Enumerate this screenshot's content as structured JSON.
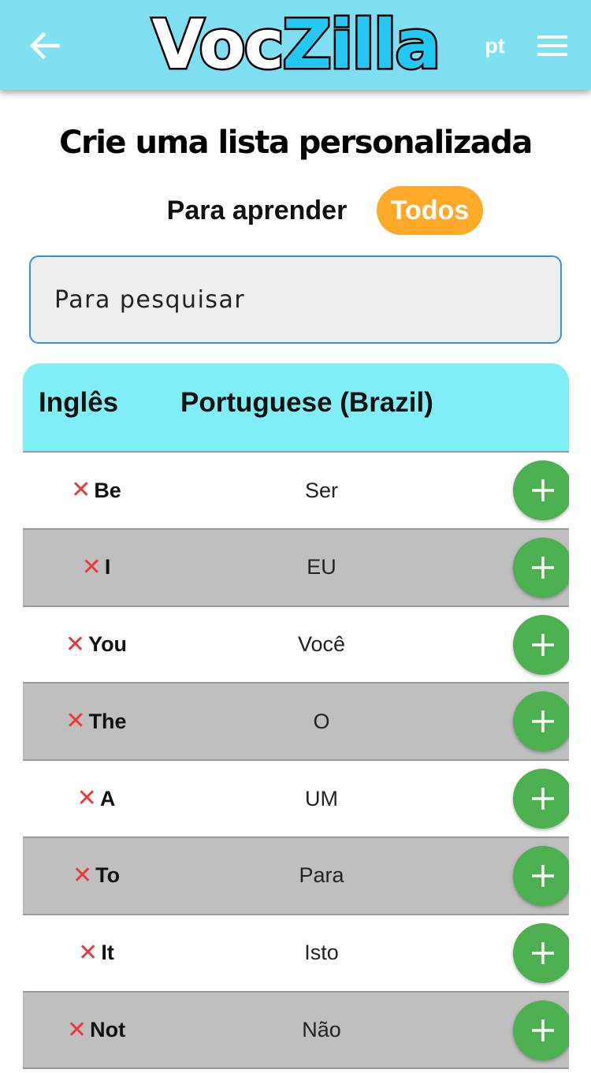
{
  "app": {
    "logo_part1": "Voc",
    "logo_part2": "Zilla",
    "language": "pt",
    "colors": {
      "appbar": "#7fe1f0",
      "accent_orange": "#ffa928",
      "add_green": "#4caf50",
      "remove_red": "#ea3a3a",
      "table_header": "#80eef6"
    },
    "icons": {
      "back": "arrow-left-icon",
      "menu": "hamburger-menu-icon",
      "remove": "close-icon",
      "add": "plus-icon"
    }
  },
  "page": {
    "title": "Crie uma lista personalizada",
    "filter_learn": "Para aprender",
    "filter_all": "Todos",
    "search_placeholder": "Para pesquisar"
  },
  "table": {
    "col_source": "Inglês",
    "col_target": "Portuguese (Brazil)",
    "rows": [
      {
        "en": "Be",
        "pt": "Ser"
      },
      {
        "en": "I",
        "pt": "EU"
      },
      {
        "en": "You",
        "pt": "Você"
      },
      {
        "en": "The",
        "pt": "O"
      },
      {
        "en": "A",
        "pt": "UM"
      },
      {
        "en": "To",
        "pt": "Para"
      },
      {
        "en": "It",
        "pt": "Isto"
      },
      {
        "en": "Not",
        "pt": "Não"
      }
    ]
  }
}
